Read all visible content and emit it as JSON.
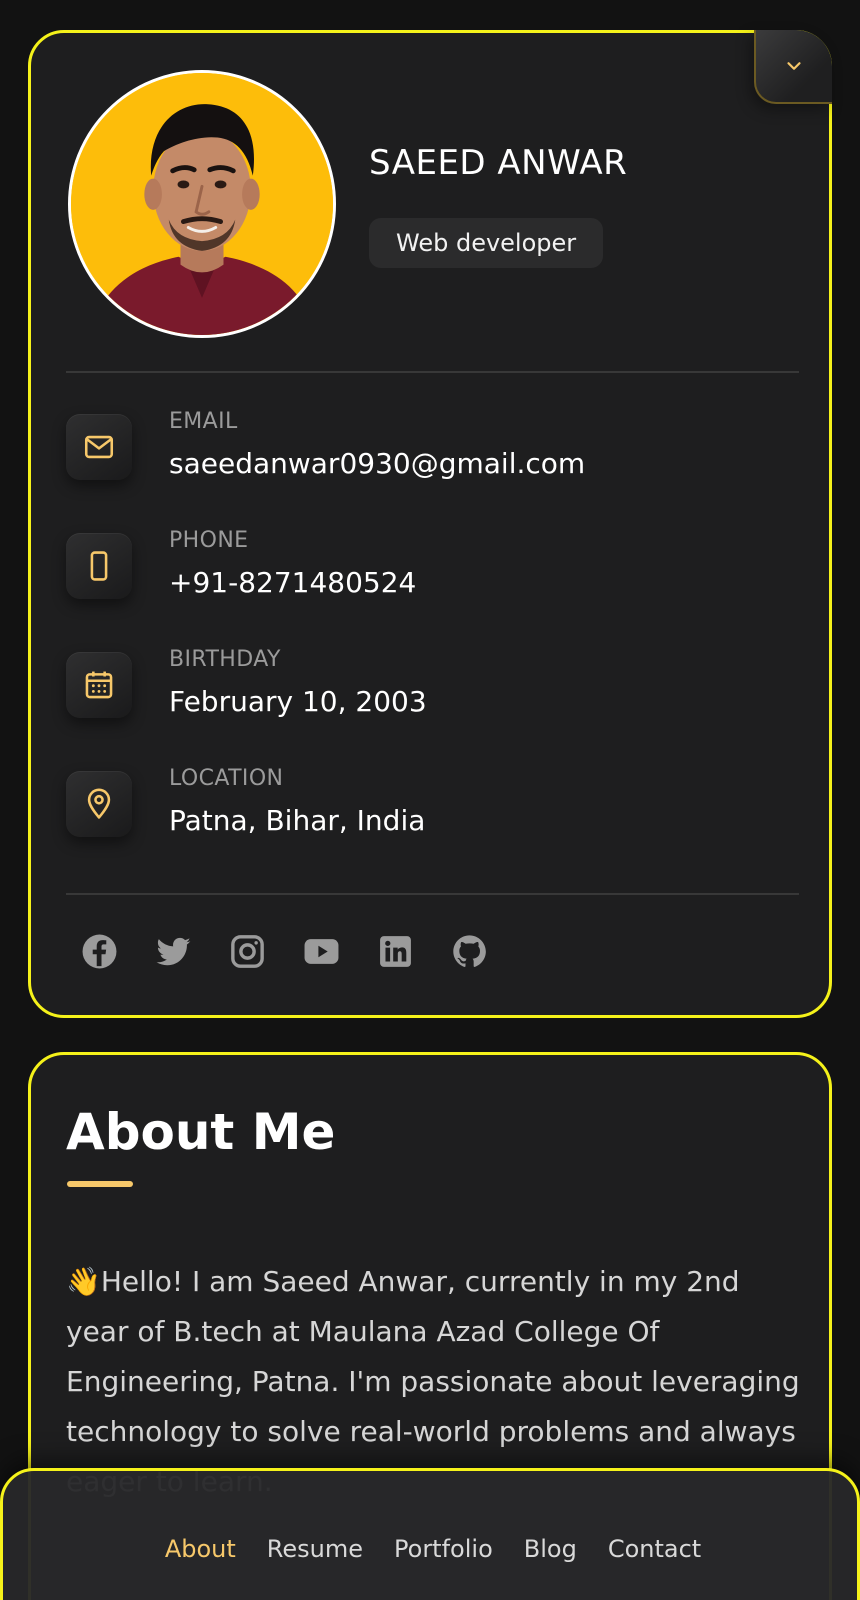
{
  "profile": {
    "name": "SAEED ANWAR",
    "title": "Web developer"
  },
  "contacts": [
    {
      "label": "EMAIL",
      "value": "saeedanwar0930@gmail.com",
      "icon": "mail-icon"
    },
    {
      "label": "PHONE",
      "value": "+91-8271480524",
      "icon": "phone-icon"
    },
    {
      "label": "BIRTHDAY",
      "value": "February 10, 2003",
      "icon": "calendar-icon"
    },
    {
      "label": "LOCATION",
      "value": "Patna, Bihar, India",
      "icon": "location-pin-icon"
    }
  ],
  "socials": [
    "facebook-icon",
    "twitter-icon",
    "instagram-icon",
    "youtube-icon",
    "linkedin-icon",
    "github-icon"
  ],
  "about": {
    "title": "About Me",
    "text": "👋Hello! I am Saeed Anwar, currently in my 2nd year of B.tech at Maulana Azad College Of Engineering, Patna. I'm passionate about leveraging technology to solve real-world problems and always eager to learn."
  },
  "nav": {
    "items": [
      "About",
      "Resume",
      "Portfolio",
      "Blog",
      "Contact"
    ],
    "active": "About"
  },
  "colors": {
    "accent": "#f7c86a",
    "border": "#f5f21a",
    "card_bg": "#1e1e1f",
    "page_bg": "#121212"
  }
}
